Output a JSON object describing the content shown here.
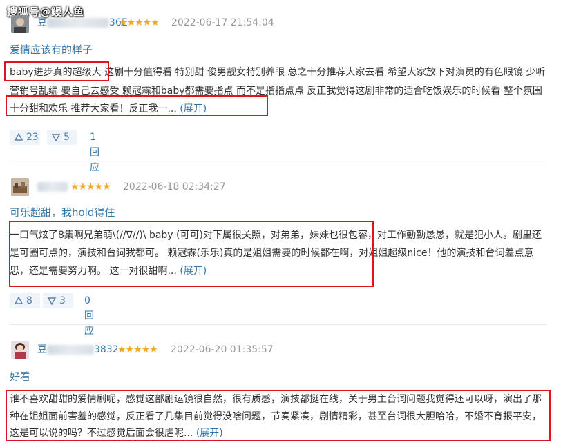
{
  "watermark": "搜狐号@鳗人鱼",
  "reviews": [
    {
      "username_visible": "豆",
      "username_tail": "36E",
      "stars": "★★★★★",
      "date": "2022-06-17 21:54:04",
      "title": "爱情应该有的样子",
      "body": "baby进步真的超级大 这剧十分值得看 特别甜 俊男靓女特别养眼 总之十分推荐大家去看 希望大家放下对演员的有色眼镜 少听营销号乱编 要自己去感受 赖冠霖和baby都需要指点 而不是指指点点 反正我觉得这剧非常的适合吃饭娱乐的时候看 整个氛围十分甜和欢乐 推荐大家看！反正我一...",
      "expand": "(展开)",
      "upvotes": "23",
      "downvotes": "5",
      "replies": "1回应"
    },
    {
      "username_visible": "",
      "username_tail": "",
      "stars": "★★★★★",
      "date": "2022-06-18 02:34:27",
      "title": "可乐超甜，我hold得住",
      "body": "一口气炫了8集啊兄弟萌\\(//∇//)\\ baby (可可)对下属很关照，对弟弟，妹妹也很包容，对工作勤勤恳恳，就是犯小人。剧里还是可圈可点的，演技和台词我都可。 赖冠霖(乐乐)真的是姐姐需要的时候都在啊，对姐姐超级nice！他的演技和台词差点意思，还是需要努力啊。 这一对很甜啊...",
      "expand": "(展开)",
      "upvotes": "8",
      "downvotes": "3",
      "replies": "0回应"
    },
    {
      "username_visible": "豆",
      "username_tail": "3832",
      "stars": "★★★★★",
      "date": "2022-06-20 01:35:57",
      "title": "好看",
      "body": "谁不喜欢甜甜的爱情剧呢，感觉这部剧运镜很自然，很有质感，演技都挺在线，关于男主台词问题我觉得还可以呀，演出了那种在姐姐面前害羞的感觉，反正看了几集目前觉得没啥问题，节奏紧凑，剧情精彩，甚至台词很大胆哈哈，不婚不育报平安，这是可以说的吗？不过感觉后面会很虐呢...",
      "expand": "(展开)"
    }
  ]
}
